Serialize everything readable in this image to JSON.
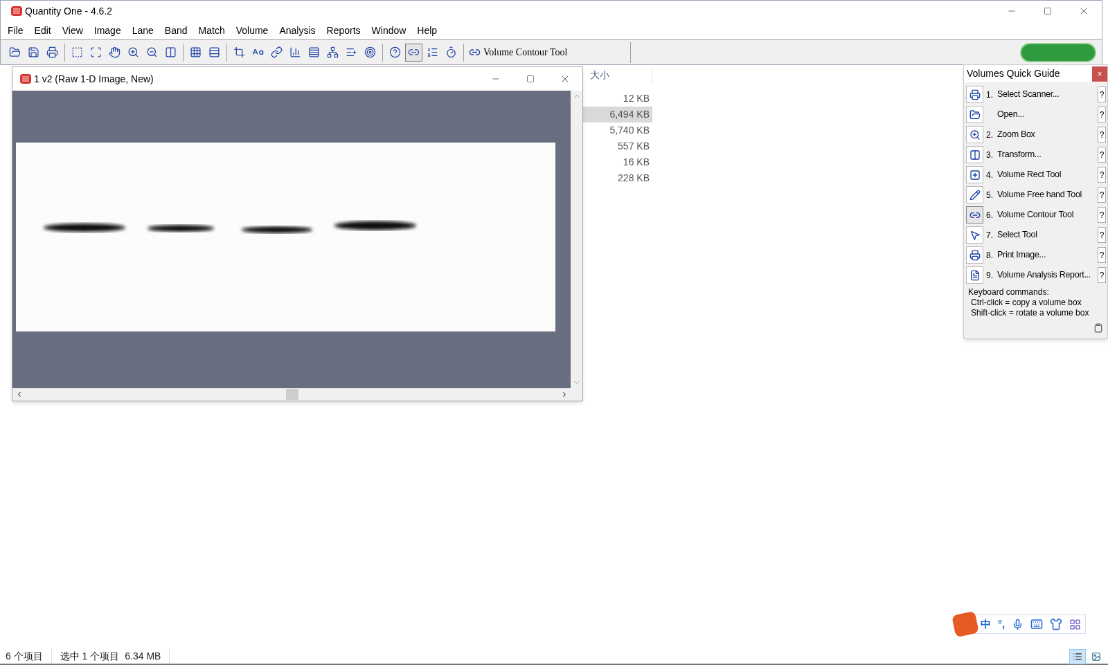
{
  "app_window": {
    "title": "Quantity One - 4.6.2"
  },
  "menu": [
    "File",
    "Edit",
    "View",
    "Image",
    "Lane",
    "Band",
    "Match",
    "Volume",
    "Analysis",
    "Reports",
    "Window",
    "Help"
  ],
  "toolbar": {
    "groups": [
      [
        {
          "selected": false
        },
        {
          "selected": false
        },
        {
          "selected": false
        }
      ],
      [
        {
          "selected": false
        },
        {
          "selected": false
        },
        {
          "selected": false
        },
        {
          "selected": false
        },
        {
          "selected": false
        },
        {
          "selected": false
        }
      ],
      [
        {
          "selected": false
        },
        {
          "selected": false
        }
      ],
      [
        {
          "selected": false
        },
        {
          "selected": false
        },
        {
          "selected": false
        },
        {
          "selected": false
        },
        {
          "selected": false
        },
        {
          "selected": false
        },
        {
          "selected": false
        },
        {
          "selected": false
        }
      ],
      [
        {
          "selected": false
        },
        {
          "selected": true
        },
        {
          "selected": false
        },
        {
          "selected": false
        }
      ]
    ],
    "current_tool": "Volume Contour Tool"
  },
  "explorer": {
    "column_header": "大小",
    "sizes": [
      {
        "text": "12 KB",
        "selected": false
      },
      {
        "text": "6,494 KB",
        "selected": true
      },
      {
        "text": "5,740 KB",
        "selected": false
      },
      {
        "text": "557 KB",
        "selected": false
      },
      {
        "text": "16 KB",
        "selected": false
      },
      {
        "text": "228 KB",
        "selected": false
      }
    ],
    "status_bar": {
      "count": "6 个项目",
      "selection": "选中 1 个项目",
      "size": "6.34 MB"
    }
  },
  "image_window": {
    "title": "1 v2 (Raw 1-D Image, New)"
  },
  "quick_guide": {
    "title": "Volumes Quick Guide",
    "close": "×",
    "steps": [
      {
        "number": "1.",
        "label": "Select Scanner...",
        "help": "?",
        "selected": false
      },
      {
        "label": "Open...",
        "help": "?",
        "selected": false
      },
      {
        "number": "2.",
        "label": "Zoom Box",
        "help": "?",
        "selected": false
      },
      {
        "number": "3.",
        "label": "Transform...",
        "help": "?",
        "selected": false
      },
      {
        "number": "4.",
        "label": "Volume Rect Tool",
        "help": "?",
        "selected": false
      },
      {
        "number": "5.",
        "label": "Volume Free hand Tool",
        "help": "?",
        "selected": false
      },
      {
        "number": "6.",
        "label": "Volume Contour Tool",
        "help": "?",
        "selected": true
      },
      {
        "number": "7.",
        "label": "Select Tool",
        "help": "?",
        "selected": false
      },
      {
        "number": "8.",
        "label": "Print Image...",
        "help": "?",
        "selected": false
      },
      {
        "number": "9.",
        "label": "Volume Analysis Report...",
        "help": "?",
        "selected": false
      }
    ],
    "keyboard_title": "Keyboard commands:",
    "keyboard_lines": [
      "Ctrl-click = copy a volume box",
      "Shift-click = rotate a volume box"
    ]
  },
  "ime_toolbar": {
    "items": [
      "中",
      "°,"
    ]
  }
}
